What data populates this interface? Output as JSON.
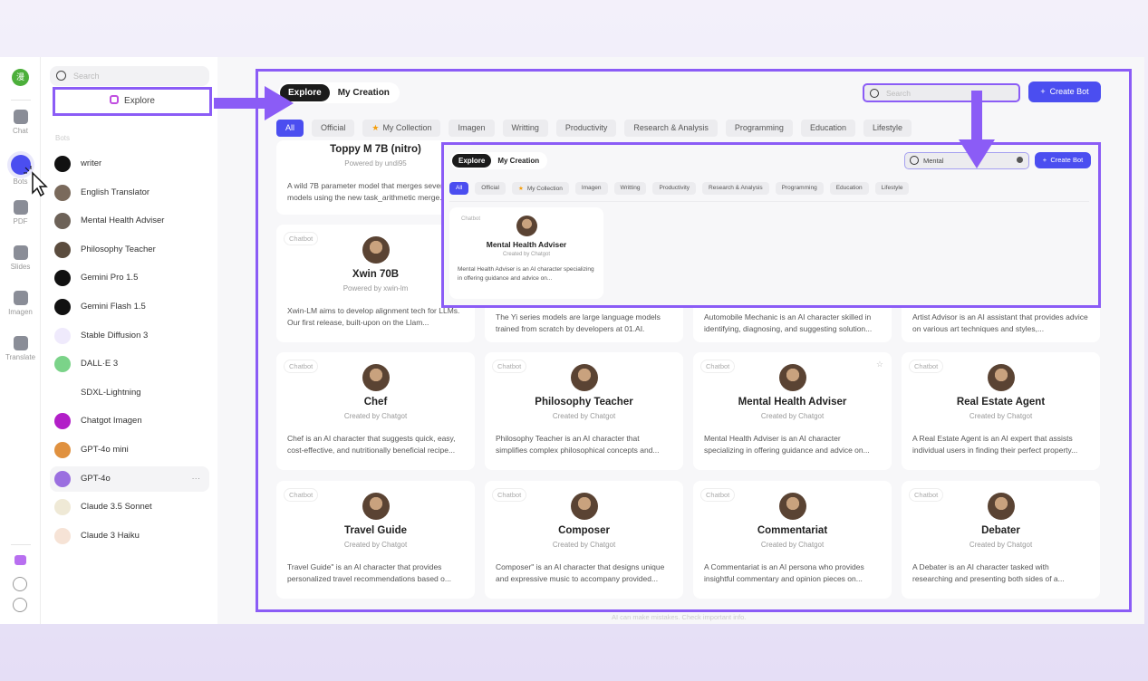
{
  "colors": {
    "accent": "#4b4ef0",
    "highlight": "#8b5cf6"
  },
  "rail": {
    "logo": "漫",
    "items": [
      {
        "label": "Chat",
        "icon": "chat-icon"
      },
      {
        "label": "Bots",
        "icon": "bot-icon",
        "active": true
      },
      {
        "label": "PDF",
        "icon": "pdf-icon"
      },
      {
        "label": "Slides",
        "icon": "slides-icon"
      },
      {
        "label": "Imagen",
        "icon": "imagen-icon"
      },
      {
        "label": "Translate",
        "icon": "translate-icon"
      }
    ],
    "bottom": [
      "gift-icon",
      "cube-icon",
      "settings-icon"
    ]
  },
  "sidebar": {
    "search_placeholder": "Search",
    "explore_label": "Explore",
    "section_label": "Bots",
    "bots": [
      {
        "label": "writer",
        "color": "#111"
      },
      {
        "label": "English Translator",
        "color": "#7a6a5c"
      },
      {
        "label": "Mental Health Adviser",
        "color": "#6d6258"
      },
      {
        "label": "Philosophy Teacher",
        "color": "#5b4c3e"
      },
      {
        "label": "Gemini Pro 1.5",
        "color": "#111"
      },
      {
        "label": "Gemini Flash 1.5",
        "color": "#111"
      },
      {
        "label": "Stable Diffusion 3",
        "color": "#efeafc"
      },
      {
        "label": "DALL·E 3",
        "color": "#7bd389"
      },
      {
        "label": "SDXL-Lightning",
        "color": "#ffffff"
      },
      {
        "label": "Chatgot Imagen",
        "color": "#b21fc8"
      },
      {
        "label": "GPT-4o mini",
        "color": "#e0913f"
      },
      {
        "label": "GPT-4o",
        "color": "#9b6fe0",
        "selected": true
      },
      {
        "label": "Claude 3.5 Sonnet",
        "color": "#efe9d6"
      },
      {
        "label": "Claude 3 Haiku",
        "color": "#f6e3d6"
      }
    ],
    "more_label": "···"
  },
  "main": {
    "tabs": [
      "Explore",
      "My Creation"
    ],
    "search_placeholder": "Search",
    "create_label": "Create Bot",
    "filters": [
      "All",
      "Official",
      "My Collection",
      "Imagen",
      "Writting",
      "Productivity",
      "Research & Analysis",
      "Programming",
      "Education",
      "Lifestyle"
    ],
    "cards": [
      {
        "tag": "",
        "title": "Toppy M 7B (nitro)",
        "sub": "Powered by undi95",
        "desc": "A wild 7B parameter model that merges several models using the new task_arithmetic merge..."
      },
      {
        "tag": "Chatbot",
        "title": "Xwin 70B",
        "sub": "Powered by xwin-lm",
        "desc": "Xwin-LM aims to develop alignment tech for LLMs. Our first release, built-upon on the Llam..."
      },
      {
        "tag": "",
        "title": "",
        "sub": "",
        "desc": "The Yi series models are large language models trained from scratch by developers at 01.AI."
      },
      {
        "tag": "",
        "title": "",
        "sub": "",
        "desc": "Automobile Mechanic is an AI character skilled in identifying, diagnosing, and suggesting solution..."
      },
      {
        "tag": "",
        "title": "",
        "sub": "",
        "desc": "Artist Advisor is an AI assistant that provides advice on various art techniques and styles,..."
      },
      {
        "tag": "Chatbot",
        "title": "Chef",
        "sub": "Created by Chatgot",
        "desc": "Chef is an AI character that suggests quick, easy, cost-effective, and nutritionally beneficial recipe..."
      },
      {
        "tag": "Chatbot",
        "title": "Philosophy Teacher",
        "sub": "Created by Chatgot",
        "desc": "Philosophy Teacher is an AI character that simplifies complex philosophical concepts and..."
      },
      {
        "tag": "Chatbot",
        "title": "Mental Health Adviser",
        "sub": "Created by Chatgot",
        "desc": "Mental Health Adviser is an AI character specializing in offering guidance and advice on...",
        "fav": "☆"
      },
      {
        "tag": "Chatbot",
        "title": "Real Estate Agent",
        "sub": "Created by Chatgot",
        "desc": "A Real Estate Agent is an AI expert that assists individual users in finding their perfect property..."
      },
      {
        "tag": "Chatbot",
        "title": "Travel Guide",
        "sub": "Created by Chatgot",
        "desc": "Travel Guide\" is an AI character that provides personalized travel recommendations based o..."
      },
      {
        "tag": "Chatbot",
        "title": "Composer",
        "sub": "Created by Chatgot",
        "desc": "Composer\" is an AI character that designs unique and expressive music to accompany provided..."
      },
      {
        "tag": "Chatbot",
        "title": "Commentariat",
        "sub": "Created by Chatgot",
        "desc": "A Commentariat is an AI persona who provides insightful commentary and opinion pieces on..."
      },
      {
        "tag": "Chatbot",
        "title": "Debater",
        "sub": "Created by Chatgot",
        "desc": "A Debater is an AI character tasked with researching and presenting both sides of a..."
      }
    ],
    "footer": "AI can make mistakes. Check important info."
  },
  "overlay": {
    "tabs": [
      "Explore",
      "My Creation"
    ],
    "search_value": "Mental",
    "create_label": "Create Bot",
    "filters": [
      "All",
      "Official",
      "My Collection",
      "Imagen",
      "Writting",
      "Productivity",
      "Research & Analysis",
      "Programming",
      "Education",
      "Lifestyle"
    ],
    "card": {
      "tag": "Chatbot",
      "title": "Mental Health Adviser",
      "sub": "Created by Chatgot",
      "desc": "Mental Health Adviser is an AI character specializing in offering guidance and advice on..."
    }
  }
}
